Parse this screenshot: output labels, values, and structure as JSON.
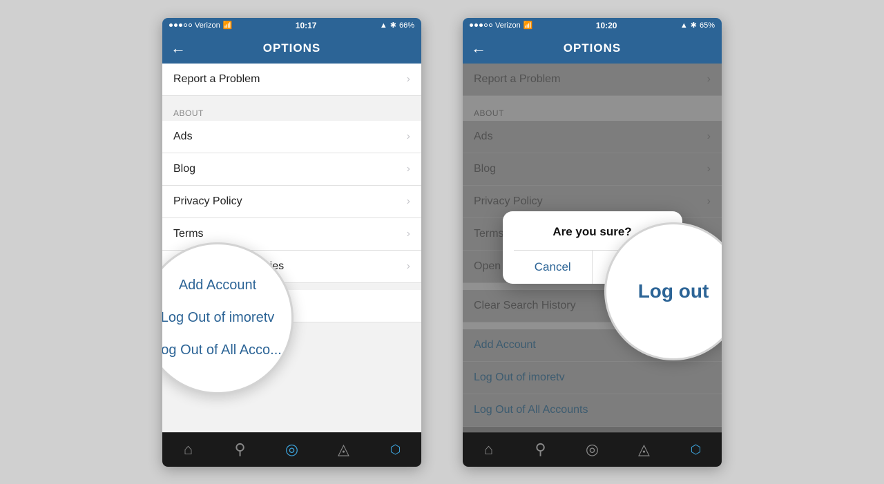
{
  "phone_left": {
    "status_bar": {
      "carrier": "Verizon",
      "time": "10:17",
      "battery": "66%"
    },
    "nav": {
      "back_icon": "←",
      "title": "OPTIONS"
    },
    "menu_items": [
      {
        "label": "Report a Problem",
        "type": "normal"
      },
      {
        "label": "ABOUT",
        "type": "section"
      },
      {
        "label": "Ads",
        "type": "normal"
      },
      {
        "label": "Blog",
        "type": "normal"
      },
      {
        "label": "Privacy Policy",
        "type": "normal"
      },
      {
        "label": "Terms",
        "type": "normal"
      },
      {
        "label": "Open Source Libraries",
        "type": "normal"
      }
    ],
    "magnifier": {
      "items": [
        "Add Account",
        "Log Out of imoretv",
        "Log Out of All Acco..."
      ]
    },
    "tab_bar": {
      "icons": [
        "⌂",
        "🔍",
        "◎",
        "💬",
        "👤"
      ]
    }
  },
  "phone_right": {
    "status_bar": {
      "carrier": "Verizon",
      "time": "10:20",
      "battery": "65%"
    },
    "nav": {
      "back_icon": "←",
      "title": "OPTIONS"
    },
    "menu_items": [
      {
        "label": "Report a Problem",
        "type": "normal"
      },
      {
        "label": "ABOUT",
        "type": "section"
      },
      {
        "label": "Ads",
        "type": "normal"
      },
      {
        "label": "Blog",
        "type": "normal"
      },
      {
        "label": "Privacy Policy",
        "type": "normal"
      },
      {
        "label": "Terms",
        "type": "normal"
      },
      {
        "label": "Open Source Libraries",
        "type": "normal"
      },
      {
        "label": "Clear Search History",
        "type": "normal"
      },
      {
        "label": "Add Account",
        "type": "action"
      },
      {
        "label": "Log Out of imoretv",
        "type": "action"
      },
      {
        "label": "Log Out of All Accounts",
        "type": "action"
      }
    ],
    "dialog": {
      "title": "Are you sure?",
      "cancel_label": "Cancel",
      "confirm_label": "Log out"
    },
    "magnifier_text": "Log out",
    "tab_bar": {
      "icons": [
        "⌂",
        "🔍",
        "◎",
        "💬",
        "👤"
      ]
    }
  },
  "chevron": "›",
  "colors": {
    "accent": "#2c6496",
    "nav_bg": "#2c6496",
    "tab_bg": "#1a1a1a"
  }
}
